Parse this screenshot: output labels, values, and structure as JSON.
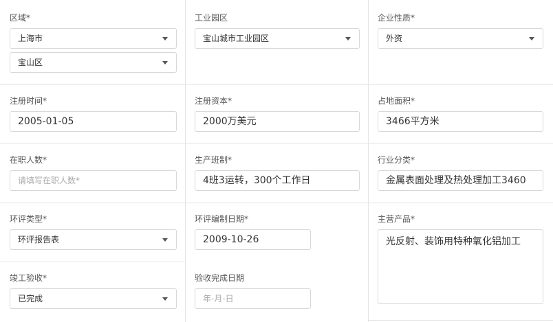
{
  "region": {
    "label": "区域*",
    "city": "上海市",
    "district": "宝山区"
  },
  "park": {
    "label": "工业园区",
    "value": "宝山城市工业园区"
  },
  "nature": {
    "label": "企业性质*",
    "value": "外资"
  },
  "reg_date": {
    "label": "注册时间*",
    "value": "2005-01-05"
  },
  "reg_capital": {
    "label": "注册资本*",
    "value": "2000万美元"
  },
  "land_area": {
    "label": "占地面积*",
    "value": "3466平方米"
  },
  "employees": {
    "label": "在职人数*",
    "placeholder": "请填写在职人数*"
  },
  "shifts": {
    "label": "生产班制*",
    "value": "4班3运转，300个工作日"
  },
  "industry": {
    "label": "行业分类*",
    "value": "金属表面处理及热处理加工3460"
  },
  "eia_type": {
    "label": "环评类型*",
    "value": "环评报告表"
  },
  "eia_date": {
    "label": "环评编制日期*",
    "value": "2009-10-26"
  },
  "main_products": {
    "label": "主营产品*",
    "value": "光反射、装饰用特种氧化铝加工"
  },
  "acceptance": {
    "label": "竣工验收*",
    "value": "已完成"
  },
  "acceptance_date": {
    "label": "验收完成日期",
    "placeholder": "年-月-日"
  }
}
